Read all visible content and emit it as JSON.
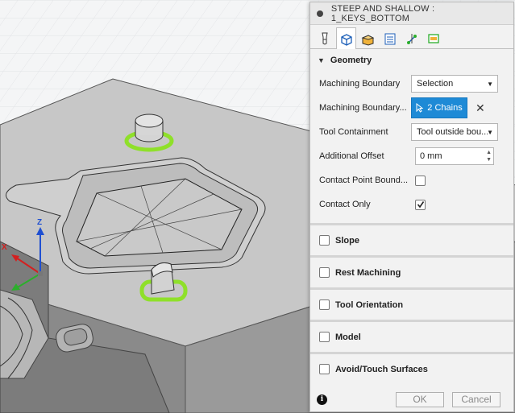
{
  "dialog": {
    "title": "STEEP AND SHALLOW : 1_KEYS_BOTTOM",
    "tabs": [
      {
        "icon": "tool-icon",
        "active": false
      },
      {
        "icon": "geometry-icon",
        "active": true
      },
      {
        "icon": "heights-icon",
        "active": false
      },
      {
        "icon": "passes-icon",
        "active": false
      },
      {
        "icon": "linking-icon",
        "active": false
      },
      {
        "icon": "post-icon",
        "active": false
      }
    ],
    "geometry": {
      "heading": "Geometry",
      "machining_boundary": {
        "label": "Machining Boundary",
        "value": "Selection"
      },
      "boundary_selection": {
        "label": "Machining Boundary...",
        "button": "2 Chains"
      },
      "tool_containment": {
        "label": "Tool Containment",
        "value": "Tool outside bou..."
      },
      "additional_offset": {
        "label": "Additional Offset",
        "value": "0 mm"
      },
      "contact_point": {
        "label": "Contact Point Bound...",
        "checked": false
      },
      "contact_only": {
        "label": "Contact Only",
        "checked": true
      }
    },
    "groups": [
      {
        "label": "Slope",
        "checked": false
      },
      {
        "label": "Rest Machining",
        "checked": false
      },
      {
        "label": "Tool Orientation",
        "checked": false
      },
      {
        "label": "Model",
        "checked": false
      },
      {
        "label": "Avoid/Touch Surfaces",
        "checked": false
      }
    ],
    "footer": {
      "ok": "OK",
      "cancel": "Cancel"
    }
  },
  "viewport": {
    "axis_labels": {
      "z": "Z",
      "x": "X"
    },
    "highlight_color": "#8fe02a",
    "selection_color": "#1e8ad6"
  }
}
